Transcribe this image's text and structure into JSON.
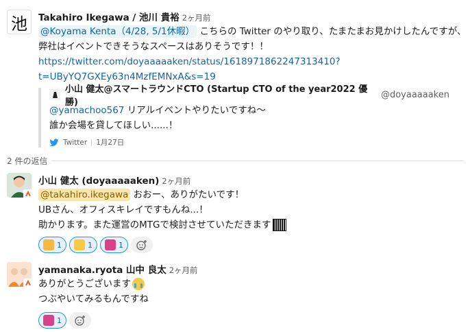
{
  "messages": [
    {
      "author": "Takahiro Ikegawa / 池川 貴裕",
      "time": "2ヶ月前",
      "avatar_char": "池",
      "mention": "@Koyama Kenta（4/28, 5/1休暇）",
      "line1_rest": " こちらの Twitter のやり取り、たまたまお見かけしたんですが、",
      "line2": "弊社はイベントできそうなスペースはありそうです！！",
      "link_line1": "https://twitter.com/doyaaaaaken/status/1618971862247313410?",
      "link_line2": "t=UByYQ7GXEy63n4MzfEMNxA&s=19"
    }
  ],
  "unfurl": {
    "author": "小山 健太@スマートラウンドCTO (Startup CTO of the year2022 優勝)",
    "handle": "@doyaaaaaken",
    "mention": "@yamachoo567",
    "line1_rest": " リアルイベントやりたいですね〜",
    "line2": "誰か会場を貸してほしい......！",
    "source": "Twitter",
    "date": "1月27日"
  },
  "replies_label": "2 件の返信",
  "reply1": {
    "author": "小山 健太 (doyaaaaaken)",
    "time": "2ヶ月前",
    "mention": "@takahiro.ikegawa",
    "line1_rest": " おおー、ありがたいです！",
    "line2": "UBさん、オフィスキレイですもんね...！",
    "line3": "助かります。また運営のMTGで検討させていただきます",
    "reactions": [
      {
        "emoji": "face-icon",
        "count": "1",
        "color": "#f5b942"
      },
      {
        "emoji": "thumbs-up-icon",
        "count": "1",
        "color": "#f7c948"
      },
      {
        "emoji": "pink-icon",
        "count": "1",
        "color": "#d9428a"
      }
    ]
  },
  "reply2": {
    "author": "yamanaka.ryota 山中 良太",
    "time": "2ヶ月前",
    "line1": "ありがとうございます",
    "line2": "つぶやいてみるもんですね",
    "reactions": [
      {
        "emoji": "pink-icon",
        "count": "1",
        "color": "#d9428a"
      }
    ]
  }
}
